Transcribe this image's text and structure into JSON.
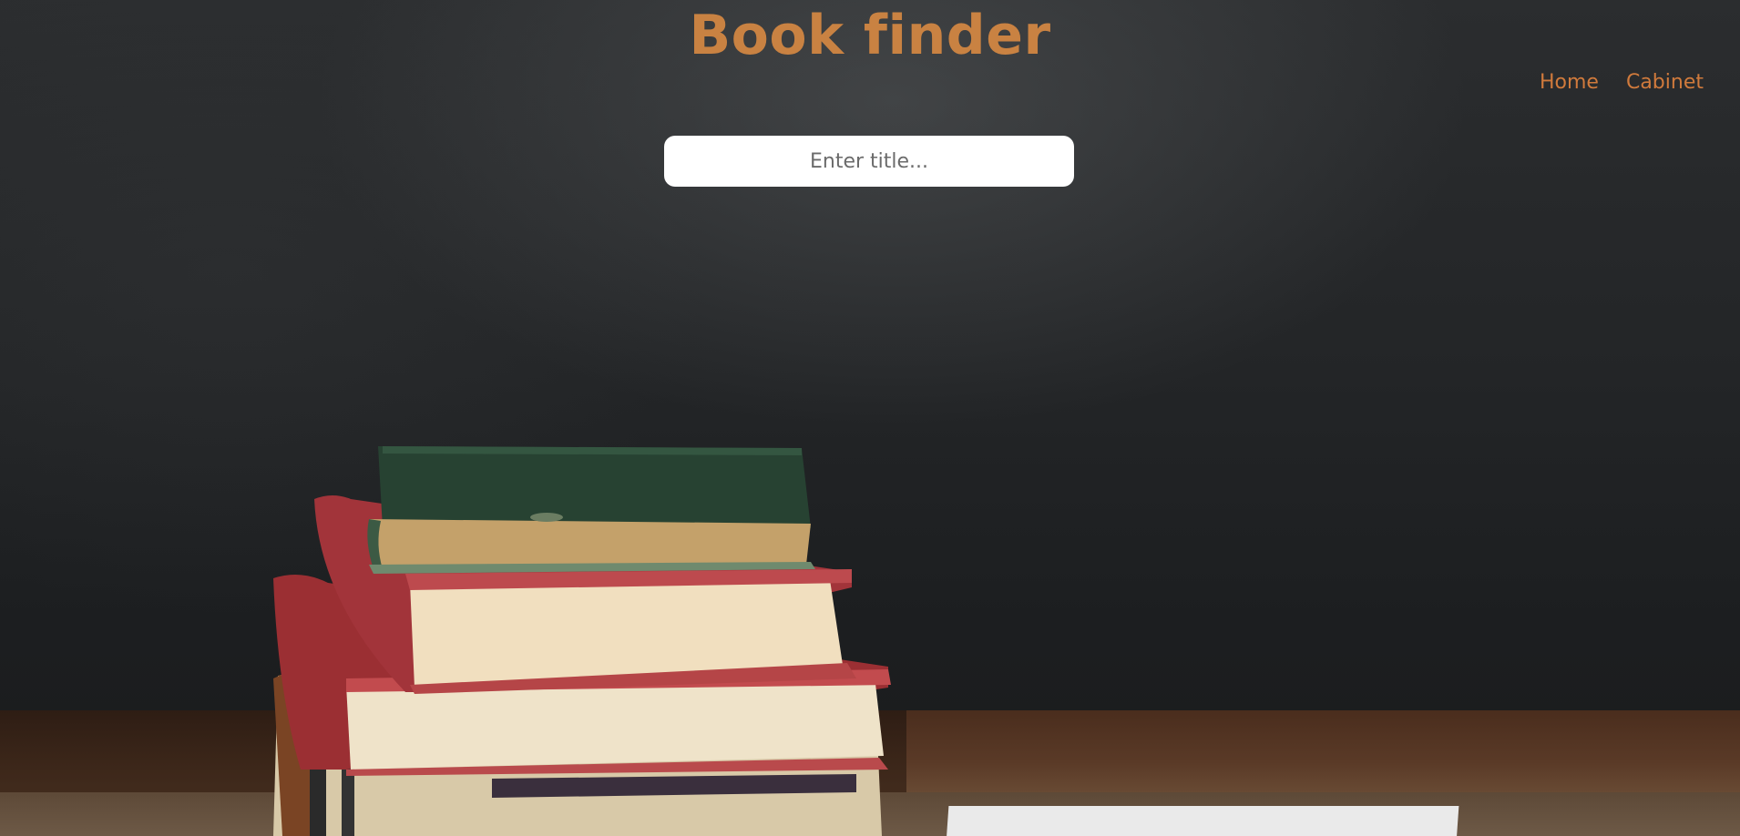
{
  "app": {
    "title": "Book finder"
  },
  "nav": {
    "items": [
      {
        "label": "Home"
      },
      {
        "label": "Cabinet"
      }
    ]
  },
  "search": {
    "placeholder": "Enter title...",
    "value": ""
  },
  "colors": {
    "accent": "#c98242",
    "nav_link": "#d07a3c",
    "background": "#232527"
  },
  "background_image": {
    "icon": "book-stack-photo"
  }
}
